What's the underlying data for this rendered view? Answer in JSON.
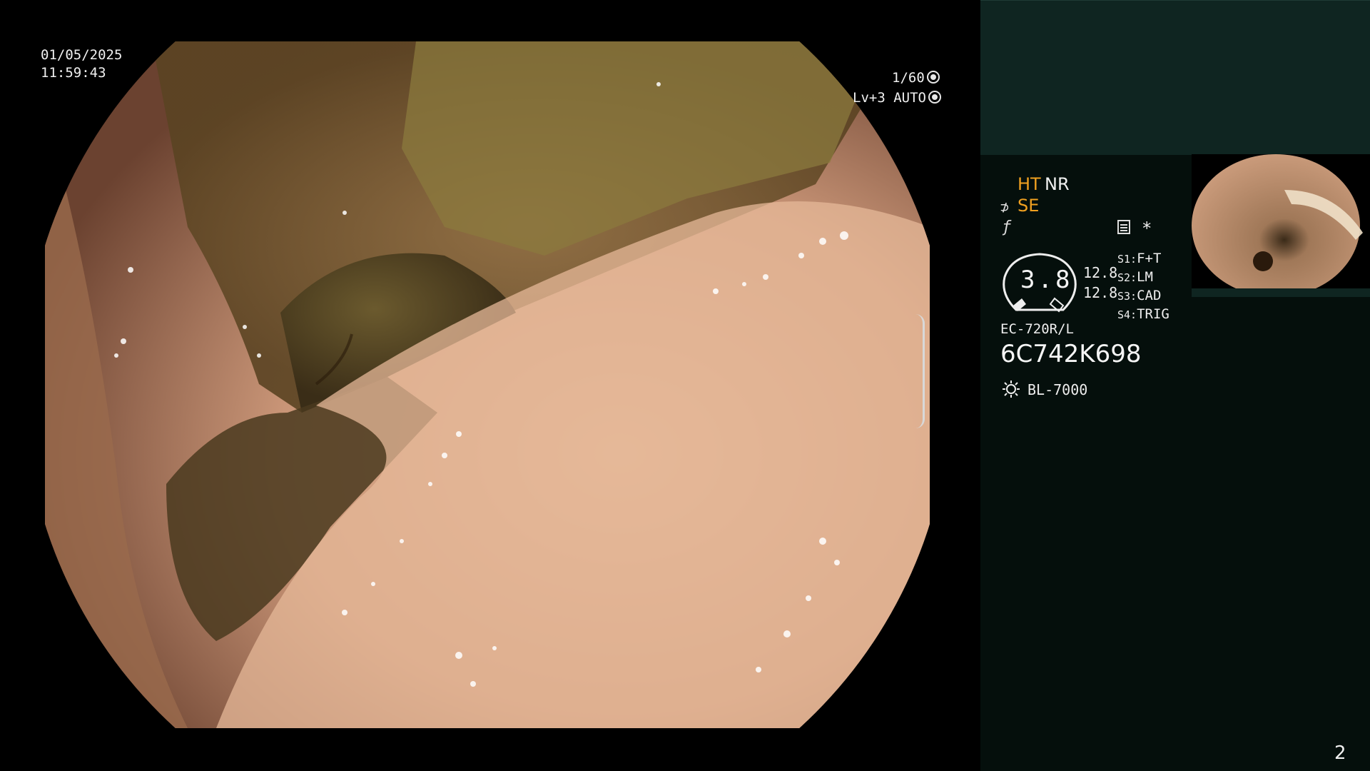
{
  "osd": {
    "date": "01/05/2025",
    "time": "11:59:43",
    "shutter": "1/60",
    "level": "Lv+3 AUTO"
  },
  "panel": {
    "ht": "HT",
    "nr": "NR",
    "se": "SE",
    "star": "*",
    "gauge_value": "3.8",
    "value_a": "12.8",
    "value_b": "12.8",
    "scope_buttons": [
      {
        "key": "S1:",
        "value": "F+T"
      },
      {
        "key": "S2:",
        "value": "LM"
      },
      {
        "key": "S3:",
        "value": "CAD"
      },
      {
        "key": "S4:",
        "value": "TRIG"
      }
    ],
    "model": "EC-720R/L",
    "serial": "6C742K698",
    "light_source": "BL-7000",
    "page_number": "2"
  },
  "colors": {
    "panel_bg": "#050f0c",
    "panel_header": "#0f2521",
    "accent_orange": "#f0a020"
  }
}
